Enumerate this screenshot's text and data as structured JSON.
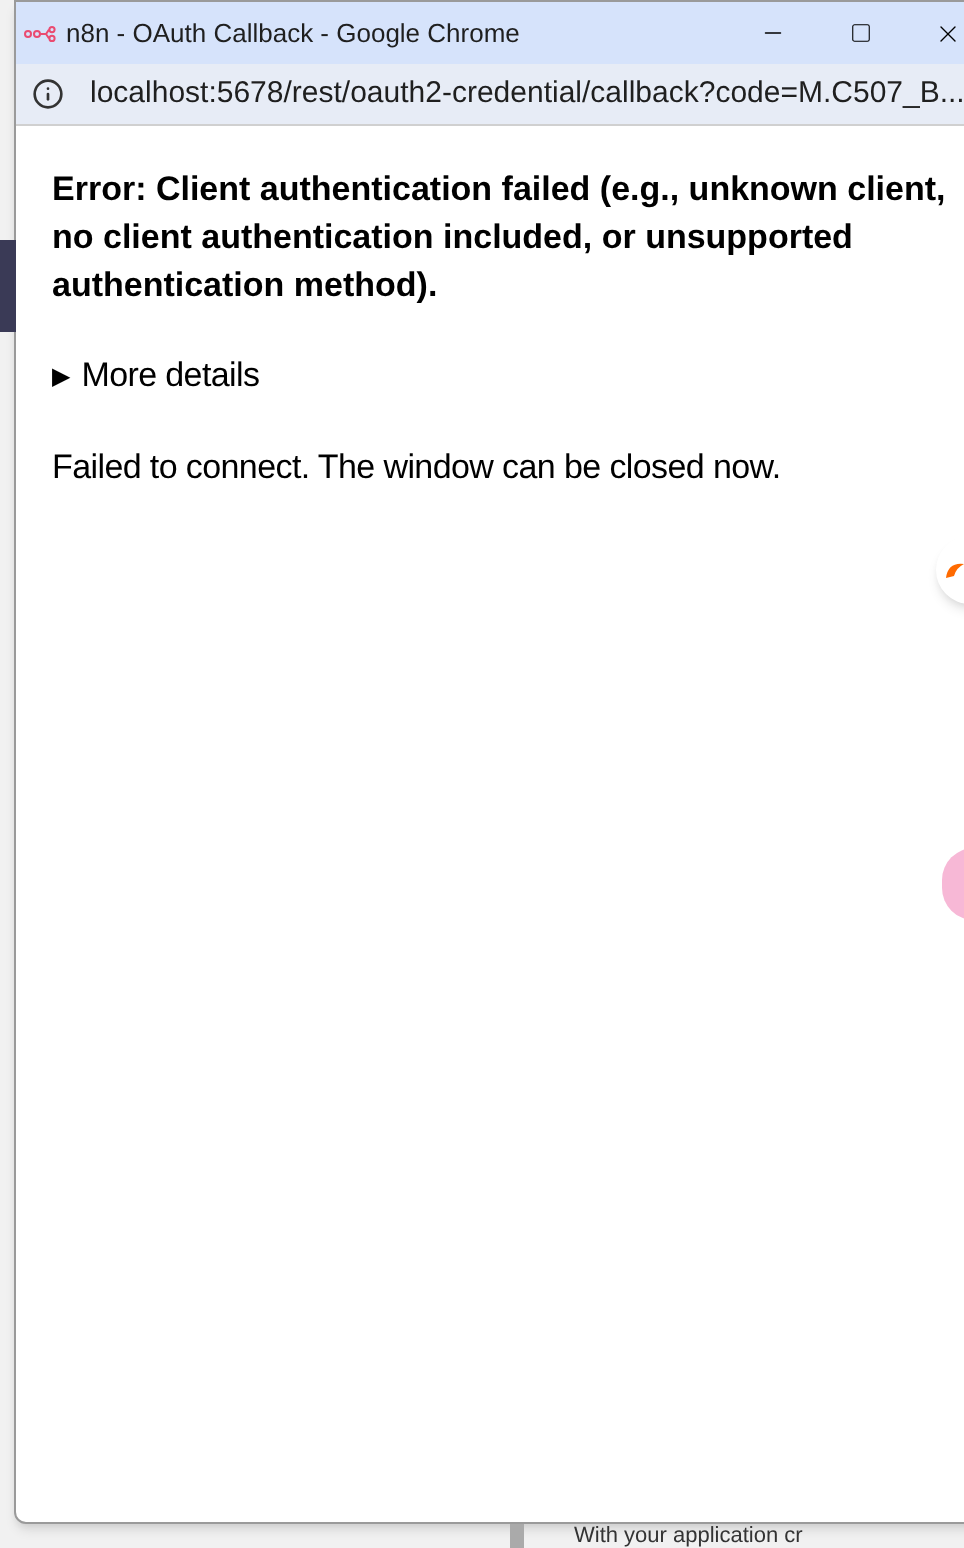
{
  "window": {
    "title": "n8n - OAuth Callback - Google Chrome"
  },
  "address_bar": {
    "url": "localhost:5678/rest/oauth2-credential/callback?code=M.C507_B..."
  },
  "page": {
    "error": "Error: Client authentication failed (e.g., unknown client, no client authentication included, or unsupported authentication method).",
    "details": {
      "marker": "▶",
      "label": "More details",
      "expanded": false
    },
    "message": "Failed to connect. The window can be closed now."
  },
  "background_page": {
    "text": "With your application cr"
  }
}
